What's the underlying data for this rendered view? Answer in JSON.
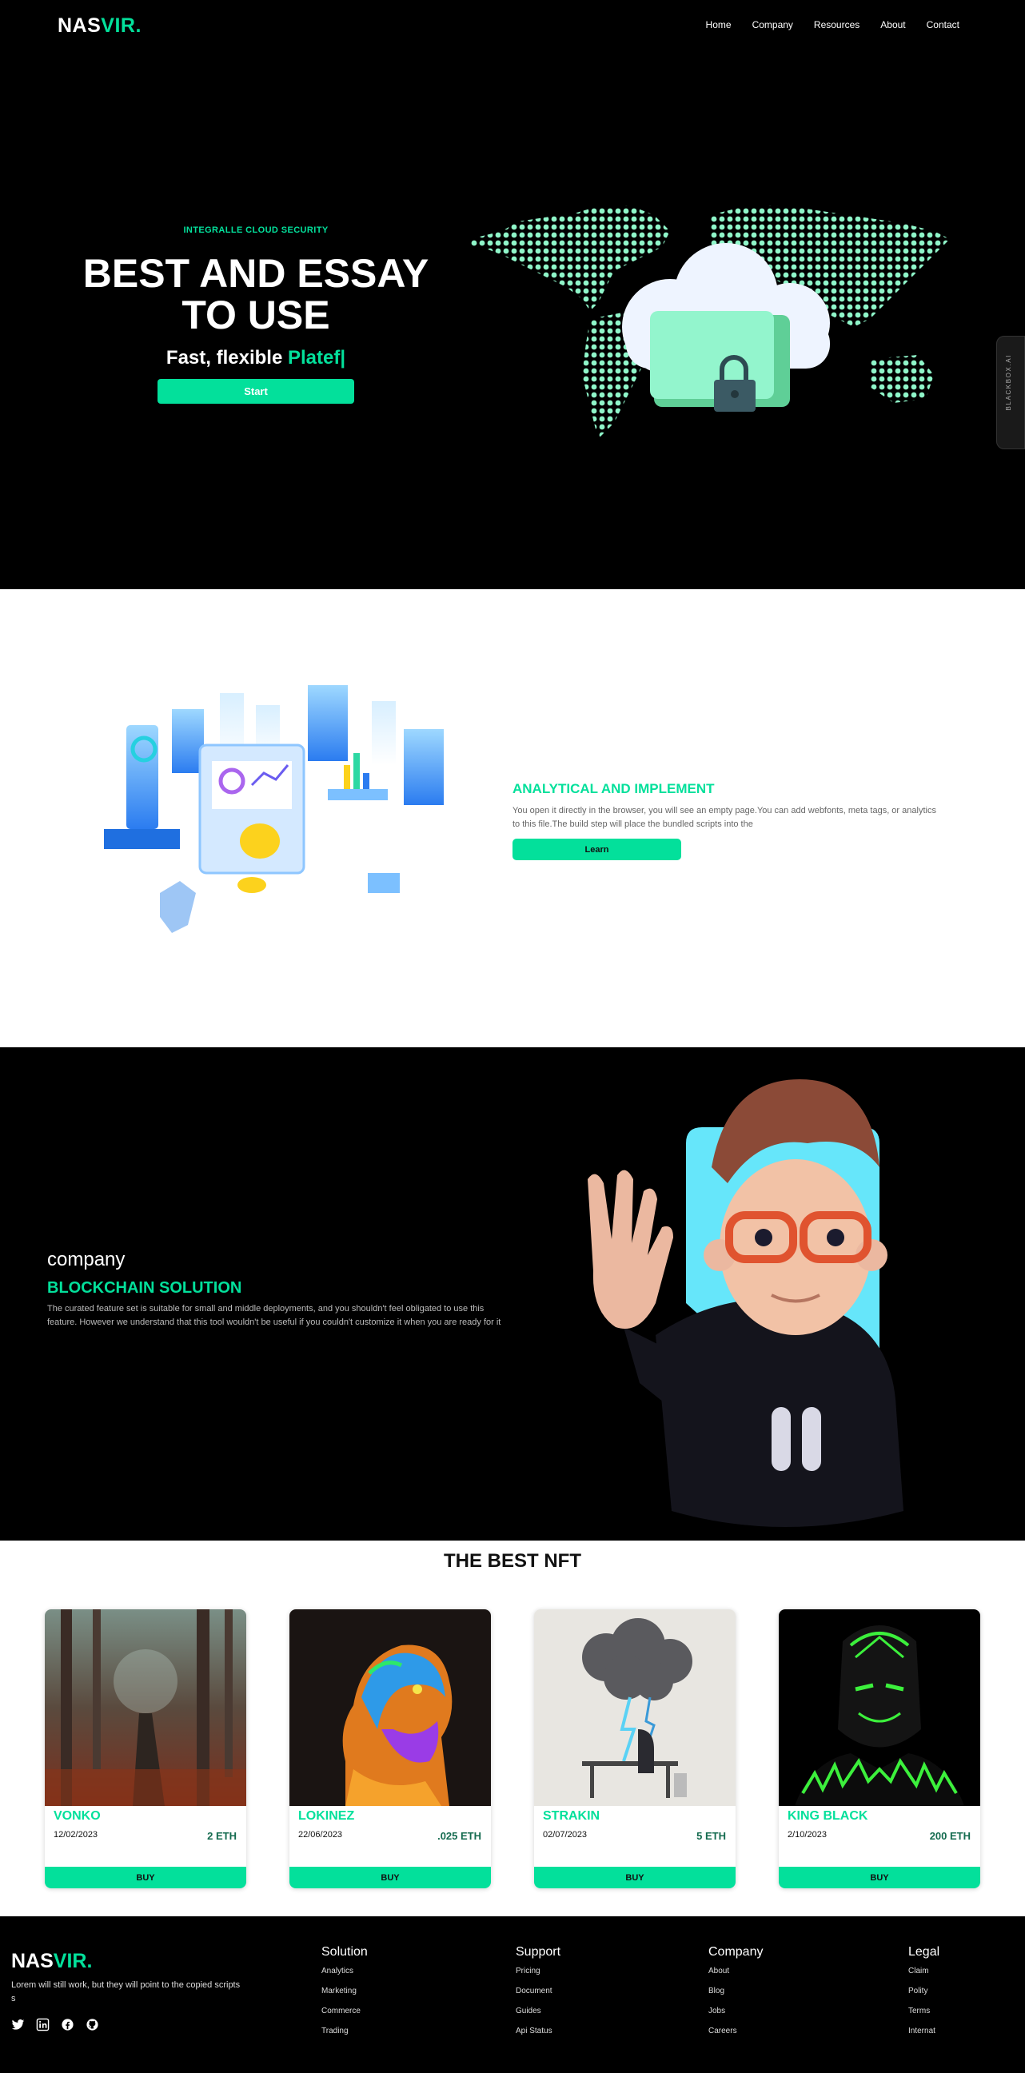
{
  "brand": {
    "logo_a": "NAS",
    "logo_b": "VIR."
  },
  "nav": {
    "links": [
      "Home",
      "Company",
      "Resources",
      "About",
      "Contact"
    ]
  },
  "hero": {
    "eyebrow": "INTEGRALLE CLOUD SECURITY",
    "title": "BEST AND ESSAY TO USE",
    "subtitle_static": "Fast, flexible",
    "subtitle_typed": "Platef|",
    "button": "Start"
  },
  "side_tab": {
    "label": "BLACKBOX.AI"
  },
  "analytic": {
    "title": "ANALYTICAL AND IMPLEMENT",
    "body": "You open it directly in the browser, you will see an empty page.You can add webfonts, meta tags, or analytics to this file.The build step will place the bundled scripts into the",
    "button": "Learn"
  },
  "blockchain": {
    "kicker": "company",
    "title": "BLOCKCHAIN SOLUTION",
    "body": "The curated feature set is suitable for small and middle deployments, and you shouldn't feel obligated to use this feature. However we understand that this tool wouldn't be useful if you couldn't customize it when you are ready for it"
  },
  "nft": {
    "title": "THE BEST NFT",
    "buy_label": "BUY",
    "cards": [
      {
        "name": "VONKO",
        "date": "12/02/2023",
        "price": "2 ETH"
      },
      {
        "name": "LOKINEZ",
        "date": "22/06/2023",
        "price": ".025 ETH"
      },
      {
        "name": "STRAKIN",
        "date": "02/07/2023",
        "price": "5 ETH"
      },
      {
        "name": "KING BLACK",
        "date": "2/10/2023",
        "price": "200 ETH"
      }
    ]
  },
  "footer": {
    "tagline": "Lorem will still work, but they will point to the copied scripts s",
    "socials": [
      "twitter-icon",
      "linkedin-icon",
      "facebook-icon",
      "github-icon"
    ],
    "columns": [
      {
        "title": "Solution",
        "links": [
          "Analytics",
          "Marketing",
          "Commerce",
          "Trading"
        ]
      },
      {
        "title": "Support",
        "links": [
          "Pricing",
          "Document",
          "Guides",
          "Api Status"
        ]
      },
      {
        "title": "Company",
        "links": [
          "About",
          "Blog",
          "Jobs",
          "Careers"
        ]
      },
      {
        "title": "Legal",
        "links": [
          "Claim",
          "Polity",
          "Terms",
          "Internat"
        ]
      }
    ]
  },
  "colors": {
    "accent": "#03e09b",
    "dark": "#000000",
    "sky": "#66e6fa"
  }
}
